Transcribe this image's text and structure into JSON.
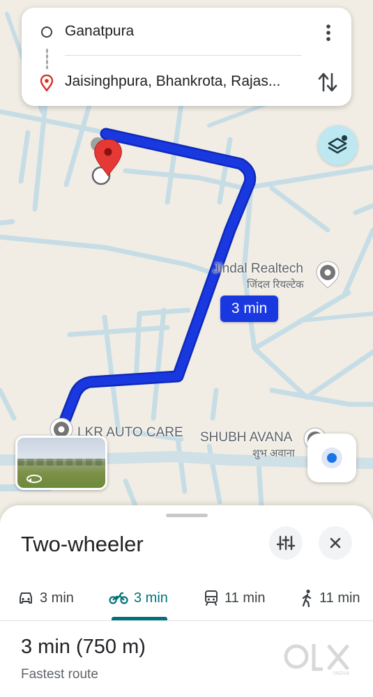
{
  "search": {
    "origin": "Ganatpura",
    "destination": "Jaisinghpura, Bhankrota, Rajas..."
  },
  "map": {
    "eta_label": "3 min",
    "pois": [
      {
        "name": "Jindal Realtech",
        "subtitle": "जिंदल रियल्टेक"
      },
      {
        "name": "LKR AUTO CARE"
      },
      {
        "name": "SHUBH AVANA",
        "subtitle": "शुभ अवाना"
      }
    ],
    "colors": {
      "route": "#1a38e0",
      "destination_pin": "#d93025",
      "background": "#f1ede4",
      "roads": "#c7dde6"
    }
  },
  "sheet": {
    "title": "Two-wheeler",
    "modes": [
      {
        "icon": "car-icon",
        "label": "3 min"
      },
      {
        "icon": "motorcycle-icon",
        "label": "3 min",
        "active": true
      },
      {
        "icon": "transit-icon",
        "label": "11 min"
      },
      {
        "icon": "walk-icon",
        "label": "11 min"
      }
    ],
    "route_summary": "3 min (750 m)",
    "route_description": "Fastest route",
    "accent": "#00737a"
  },
  "watermark": {
    "text": "OLX",
    "sub": "INDIA"
  }
}
